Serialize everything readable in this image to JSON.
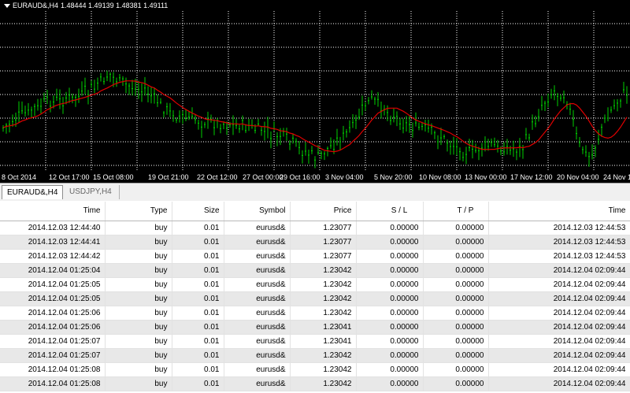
{
  "chart": {
    "symbol": "EURAUD&,H4",
    "ohlc": "1.48444 1.49139 1.48381 1.49111",
    "x_labels": [
      "8 Oct 2014",
      "12 Oct 17:00",
      "15 Oct 08:00",
      "19 Oct 21:00",
      "22 Oct 12:00",
      "27 Oct 00:00",
      "29 Oct 16:00",
      "3 Nov 04:00",
      "5 Nov 20:00",
      "10 Nov 08:00",
      "13 Nov 00:00",
      "17 Nov 12:00",
      "20 Nov 04:00",
      "24 Nov 1"
    ],
    "colors": {
      "background": "#000000",
      "grid": "#ffffff",
      "candles": "#00d000",
      "moving_average": "#e00000"
    }
  },
  "tabs": [
    "EURAUD&,H4",
    "USDJPY,H4"
  ],
  "table": {
    "columns": [
      "Time",
      "Type",
      "Size",
      "Symbol",
      "Price",
      "S / L",
      "T / P",
      "Time"
    ],
    "rows": [
      [
        "2014.12.03 12:44:40",
        "buy",
        "0.01",
        "eurusd&",
        "1.23077",
        "0.00000",
        "0.00000",
        "2014.12.03 12:44:53"
      ],
      [
        "2014.12.03 12:44:41",
        "buy",
        "0.01",
        "eurusd&",
        "1.23077",
        "0.00000",
        "0.00000",
        "2014.12.03 12:44:53"
      ],
      [
        "2014.12.03 12:44:42",
        "buy",
        "0.01",
        "eurusd&",
        "1.23077",
        "0.00000",
        "0.00000",
        "2014.12.03 12:44:53"
      ],
      [
        "2014.12.04 01:25:04",
        "buy",
        "0.01",
        "eurusd&",
        "1.23042",
        "0.00000",
        "0.00000",
        "2014.12.04 02:09:44"
      ],
      [
        "2014.12.04 01:25:05",
        "buy",
        "0.01",
        "eurusd&",
        "1.23042",
        "0.00000",
        "0.00000",
        "2014.12.04 02:09:44"
      ],
      [
        "2014.12.04 01:25:05",
        "buy",
        "0.01",
        "eurusd&",
        "1.23042",
        "0.00000",
        "0.00000",
        "2014.12.04 02:09:44"
      ],
      [
        "2014.12.04 01:25:06",
        "buy",
        "0.01",
        "eurusd&",
        "1.23042",
        "0.00000",
        "0.00000",
        "2014.12.04 02:09:44"
      ],
      [
        "2014.12.04 01:25:06",
        "buy",
        "0.01",
        "eurusd&",
        "1.23041",
        "0.00000",
        "0.00000",
        "2014.12.04 02:09:44"
      ],
      [
        "2014.12.04 01:25:07",
        "buy",
        "0.01",
        "eurusd&",
        "1.23041",
        "0.00000",
        "0.00000",
        "2014.12.04 02:09:44"
      ],
      [
        "2014.12.04 01:25:07",
        "buy",
        "0.01",
        "eurusd&",
        "1.23042",
        "0.00000",
        "0.00000",
        "2014.12.04 02:09:44"
      ],
      [
        "2014.12.04 01:25:08",
        "buy",
        "0.01",
        "eurusd&",
        "1.23042",
        "0.00000",
        "0.00000",
        "2014.12.04 02:09:44"
      ],
      [
        "2014.12.04 01:25:08",
        "buy",
        "0.01",
        "eurusd&",
        "1.23042",
        "0.00000",
        "0.00000",
        "2014.12.04 02:09:44"
      ]
    ]
  }
}
